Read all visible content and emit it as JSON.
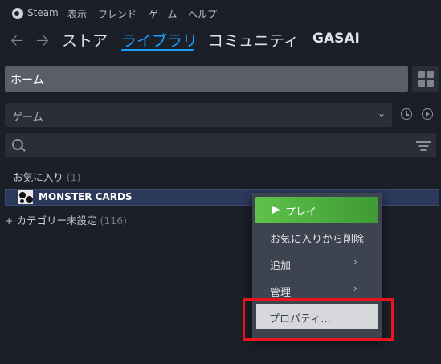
{
  "top_menu": {
    "app": "Steam",
    "view": "表示",
    "friends": "フレンド",
    "games": "ゲーム",
    "help": "ヘルプ"
  },
  "nav": {
    "back_icon": "arrow-left",
    "forward_icon": "arrow-right",
    "store": "ストア",
    "library": "ライブラリ",
    "community": "コミュニティ",
    "user": "GASAI",
    "active": "library"
  },
  "home": {
    "label": "ホーム"
  },
  "filter": {
    "selected": "ゲーム"
  },
  "search": {
    "value": "",
    "placeholder": ""
  },
  "library": {
    "favorites": {
      "expand_mark": "–",
      "name": "お気に入り",
      "count": "(1)"
    },
    "game": {
      "name": "MONSTER CARDS"
    },
    "uncategorized": {
      "expand_mark": "+",
      "name": "カテゴリー未設定",
      "count": "(116)"
    }
  },
  "context_menu": {
    "play": "プレイ",
    "remove_favorite": "お気に入りから削除",
    "add": "追加",
    "manage": "管理",
    "submenu_arrow": "›",
    "properties": "プロパティ..."
  },
  "colors": {
    "accent": "#1a9fff",
    "play_green": "#5fc24a",
    "highlight_red": "#e8141e",
    "selected_row": "#2b3a5a"
  }
}
